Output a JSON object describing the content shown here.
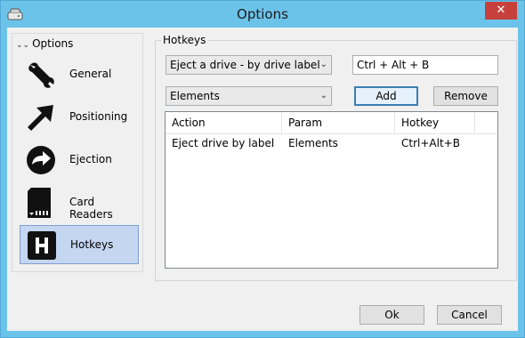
{
  "window": {
    "title": "Options"
  },
  "sidebar": {
    "header": "Options",
    "items": [
      {
        "label": "General",
        "icon": "wrench-icon"
      },
      {
        "label": "Positioning",
        "icon": "arrow-icon"
      },
      {
        "label": "Ejection",
        "icon": "eject-icon"
      },
      {
        "label": "Card Readers",
        "icon": "sd-card-icon"
      },
      {
        "label": "Hotkeys",
        "icon": "hotkey-h-icon",
        "selected": true
      }
    ]
  },
  "hotkeys": {
    "group_label": "Hotkeys",
    "action_select": "Eject a drive - by drive label",
    "hotkey_value": "Ctrl + Alt + B",
    "param_select": "Elements",
    "add_label": "Add",
    "remove_label": "Remove",
    "columns": [
      "Action",
      "Param",
      "Hotkey"
    ],
    "rows": [
      {
        "action": "Eject drive by label",
        "param": "Elements",
        "hotkey": "Ctrl+Alt+B"
      }
    ]
  },
  "footer": {
    "ok_label": "Ok",
    "cancel_label": "Cancel"
  },
  "colors": {
    "titlebar": "#6cc3ea",
    "close": "#c7413c",
    "selection": "#c5d6f1"
  }
}
